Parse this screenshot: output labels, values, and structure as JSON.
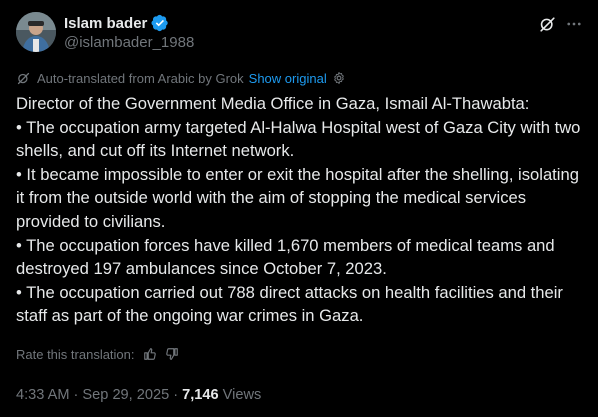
{
  "author": {
    "display_name": "Islam bader",
    "handle": "@islambader_1988",
    "verified_color": "#1d9bf0",
    "avatar_icon": "avatar-photo"
  },
  "header_actions": {
    "grok_icon": "grok-icon",
    "more_icon": "more-icon"
  },
  "translation": {
    "notice": "Auto-translated from Arabic by Grok",
    "show_original": "Show original",
    "rate_label": "Rate this translation:"
  },
  "tweet": {
    "lines": [
      "Director of the Government Media Office in Gaza, Ismail Al-Thawabta:",
      "• The occupation army targeted Al-Halwa Hospital west of Gaza City with two shells, and cut off its Internet network.",
      "• It became impossible to enter or exit the hospital after the shelling, isolating it from the outside world with the aim of stopping the medical services provided to civilians.",
      "• The occupation forces have killed 1,670 members of medical teams and destroyed 197 ambulances since October 7, 2023.",
      "• The occupation carried out 788 direct attacks on health facilities and their staff as part of the ongoing war crimes in Gaza."
    ]
  },
  "meta": {
    "time": "4:33 AM",
    "separator": "·",
    "date": "Sep 29, 2025",
    "views_count": "7,146",
    "views_label": "Views"
  },
  "colors": {
    "background": "#000000",
    "text": "#e7e9ea",
    "muted": "#71767b",
    "accent": "#1d9bf0"
  }
}
